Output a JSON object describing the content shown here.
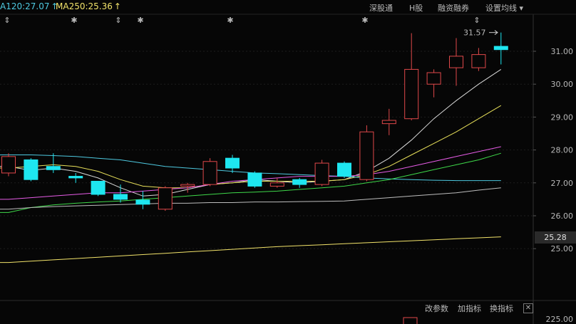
{
  "indicators": [
    {
      "label": "A120:27.07",
      "color": "#4ec9e0",
      "arrow": "↑"
    },
    {
      "label": "MA250:25.36",
      "color": "#f2e36a",
      "arrow": "↑"
    }
  ],
  "toolbar": [
    "深股通",
    "H股",
    "融资融券",
    "设置均线 ▾"
  ],
  "event_marks": [
    "⇕",
    "✱",
    "⇕",
    "✱",
    "✱",
    "✱",
    "⇕"
  ],
  "high_label": "31.57",
  "current_price_tag": "25.28",
  "bottom_buttons": [
    "改参数",
    "加指标",
    "换指标"
  ],
  "close_icon": "✕",
  "volume_axis_label": "225.00",
  "colors": {
    "up": "#e0484a",
    "down": "#1ee6f0",
    "background": "#060606"
  },
  "chart_data": {
    "type": "candlestick",
    "y_ticks": [
      "31.00",
      "30.00",
      "29.00",
      "28.00",
      "27.00",
      "26.00",
      "25.00"
    ],
    "ylim": [
      24.45,
      31.7
    ],
    "candles": [
      {
        "o": 27.3,
        "h": 27.9,
        "l": 27.2,
        "c": 27.8,
        "dir": "up"
      },
      {
        "o": 27.7,
        "h": 27.75,
        "l": 27.05,
        "c": 27.1,
        "dir": "down"
      },
      {
        "o": 27.5,
        "h": 27.9,
        "l": 27.3,
        "c": 27.4,
        "dir": "down"
      },
      {
        "o": 27.2,
        "h": 27.3,
        "l": 27.0,
        "c": 27.15,
        "dir": "down"
      },
      {
        "o": 27.05,
        "h": 27.05,
        "l": 26.6,
        "c": 26.65,
        "dir": "down"
      },
      {
        "o": 26.65,
        "h": 26.95,
        "l": 26.4,
        "c": 26.5,
        "dir": "down"
      },
      {
        "o": 26.48,
        "h": 26.75,
        "l": 26.2,
        "c": 26.35,
        "dir": "down"
      },
      {
        "o": 26.2,
        "h": 26.9,
        "l": 26.15,
        "c": 26.85,
        "dir": "up"
      },
      {
        "o": 26.9,
        "h": 27.0,
        "l": 26.7,
        "c": 26.95,
        "dir": "up"
      },
      {
        "o": 26.95,
        "h": 27.75,
        "l": 26.9,
        "c": 27.65,
        "dir": "up"
      },
      {
        "o": 27.75,
        "h": 27.85,
        "l": 27.3,
        "c": 27.45,
        "dir": "down"
      },
      {
        "o": 27.3,
        "h": 27.35,
        "l": 26.85,
        "c": 26.9,
        "dir": "down"
      },
      {
        "o": 26.9,
        "h": 27.15,
        "l": 26.85,
        "c": 27.0,
        "dir": "up"
      },
      {
        "o": 27.1,
        "h": 27.15,
        "l": 26.85,
        "c": 26.95,
        "dir": "down"
      },
      {
        "o": 26.95,
        "h": 27.7,
        "l": 26.9,
        "c": 27.6,
        "dir": "up"
      },
      {
        "o": 27.6,
        "h": 27.65,
        "l": 27.15,
        "c": 27.2,
        "dir": "down"
      },
      {
        "o": 27.1,
        "h": 28.75,
        "l": 27.05,
        "c": 28.55,
        "dir": "up"
      },
      {
        "o": 28.8,
        "h": 29.25,
        "l": 28.45,
        "c": 28.9,
        "dir": "up"
      },
      {
        "o": 28.95,
        "h": 31.55,
        "l": 28.9,
        "c": 30.45,
        "dir": "up"
      },
      {
        "o": 30.0,
        "h": 30.45,
        "l": 29.6,
        "c": 30.35,
        "dir": "up"
      },
      {
        "o": 30.5,
        "h": 31.4,
        "l": 29.95,
        "c": 30.85,
        "dir": "up"
      },
      {
        "o": 30.5,
        "h": 31.1,
        "l": 30.4,
        "c": 30.9,
        "dir": "up"
      },
      {
        "o": 31.15,
        "h": 31.57,
        "l": 30.6,
        "c": 31.05,
        "dir": "down"
      }
    ],
    "ma_lines": [
      {
        "name": "white",
        "color": "#d8d8d8",
        "values": [
          27.5,
          27.38,
          27.45,
          27.35,
          27.15,
          26.85,
          26.6,
          26.65,
          26.8,
          26.95,
          27.0,
          27.1,
          27.05,
          27.0,
          27.05,
          27.1,
          27.35,
          27.75,
          28.3,
          28.95,
          29.5,
          30.0,
          30.45
        ]
      },
      {
        "name": "yellow",
        "color": "#e8e05a",
        "values": [
          27.45,
          27.5,
          27.55,
          27.5,
          27.35,
          27.1,
          26.9,
          26.85,
          26.85,
          26.95,
          27.0,
          27.05,
          27.05,
          27.05,
          27.05,
          27.1,
          27.25,
          27.5,
          27.85,
          28.2,
          28.55,
          28.95,
          29.35
        ]
      },
      {
        "name": "cyan",
        "color": "#4ec9e0",
        "values": [
          27.85,
          27.85,
          27.83,
          27.8,
          27.75,
          27.7,
          27.6,
          27.5,
          27.45,
          27.4,
          27.35,
          27.3,
          27.28,
          27.25,
          27.22,
          27.2,
          27.15,
          27.12,
          27.1,
          27.08,
          27.07,
          27.07,
          27.07
        ]
      },
      {
        "name": "magenta",
        "color": "#e65ce6",
        "values": [
          26.5,
          26.55,
          26.6,
          26.65,
          26.7,
          26.7,
          26.75,
          26.8,
          26.85,
          26.95,
          27.05,
          27.1,
          27.15,
          27.2,
          27.2,
          27.2,
          27.25,
          27.35,
          27.5,
          27.65,
          27.8,
          27.95,
          28.1
        ]
      },
      {
        "name": "green",
        "color": "#3fd94a",
        "values": [
          26.1,
          26.25,
          26.33,
          26.38,
          26.42,
          26.45,
          26.5,
          26.55,
          26.6,
          26.65,
          26.7,
          26.72,
          26.75,
          26.8,
          26.85,
          26.9,
          27.0,
          27.1,
          27.25,
          27.4,
          27.55,
          27.7,
          27.9
        ]
      },
      {
        "name": "grey",
        "color": "#bdbdbd",
        "values": [
          26.2,
          26.25,
          26.28,
          26.3,
          26.32,
          26.34,
          26.36,
          26.38,
          26.38,
          26.4,
          26.4,
          26.42,
          26.42,
          26.43,
          26.44,
          26.45,
          26.5,
          26.55,
          26.6,
          26.65,
          26.7,
          26.78,
          26.85
        ]
      },
      {
        "name": "MA250",
        "color": "#f2e36a",
        "values": [
          24.58,
          24.62,
          24.66,
          24.7,
          24.74,
          24.78,
          24.82,
          24.86,
          24.9,
          24.94,
          24.98,
          25.02,
          25.06,
          25.09,
          25.12,
          25.15,
          25.18,
          25.21,
          25.24,
          25.27,
          25.3,
          25.33,
          25.36
        ]
      }
    ],
    "volume_bar": {
      "value": 225,
      "dir": "up"
    }
  }
}
